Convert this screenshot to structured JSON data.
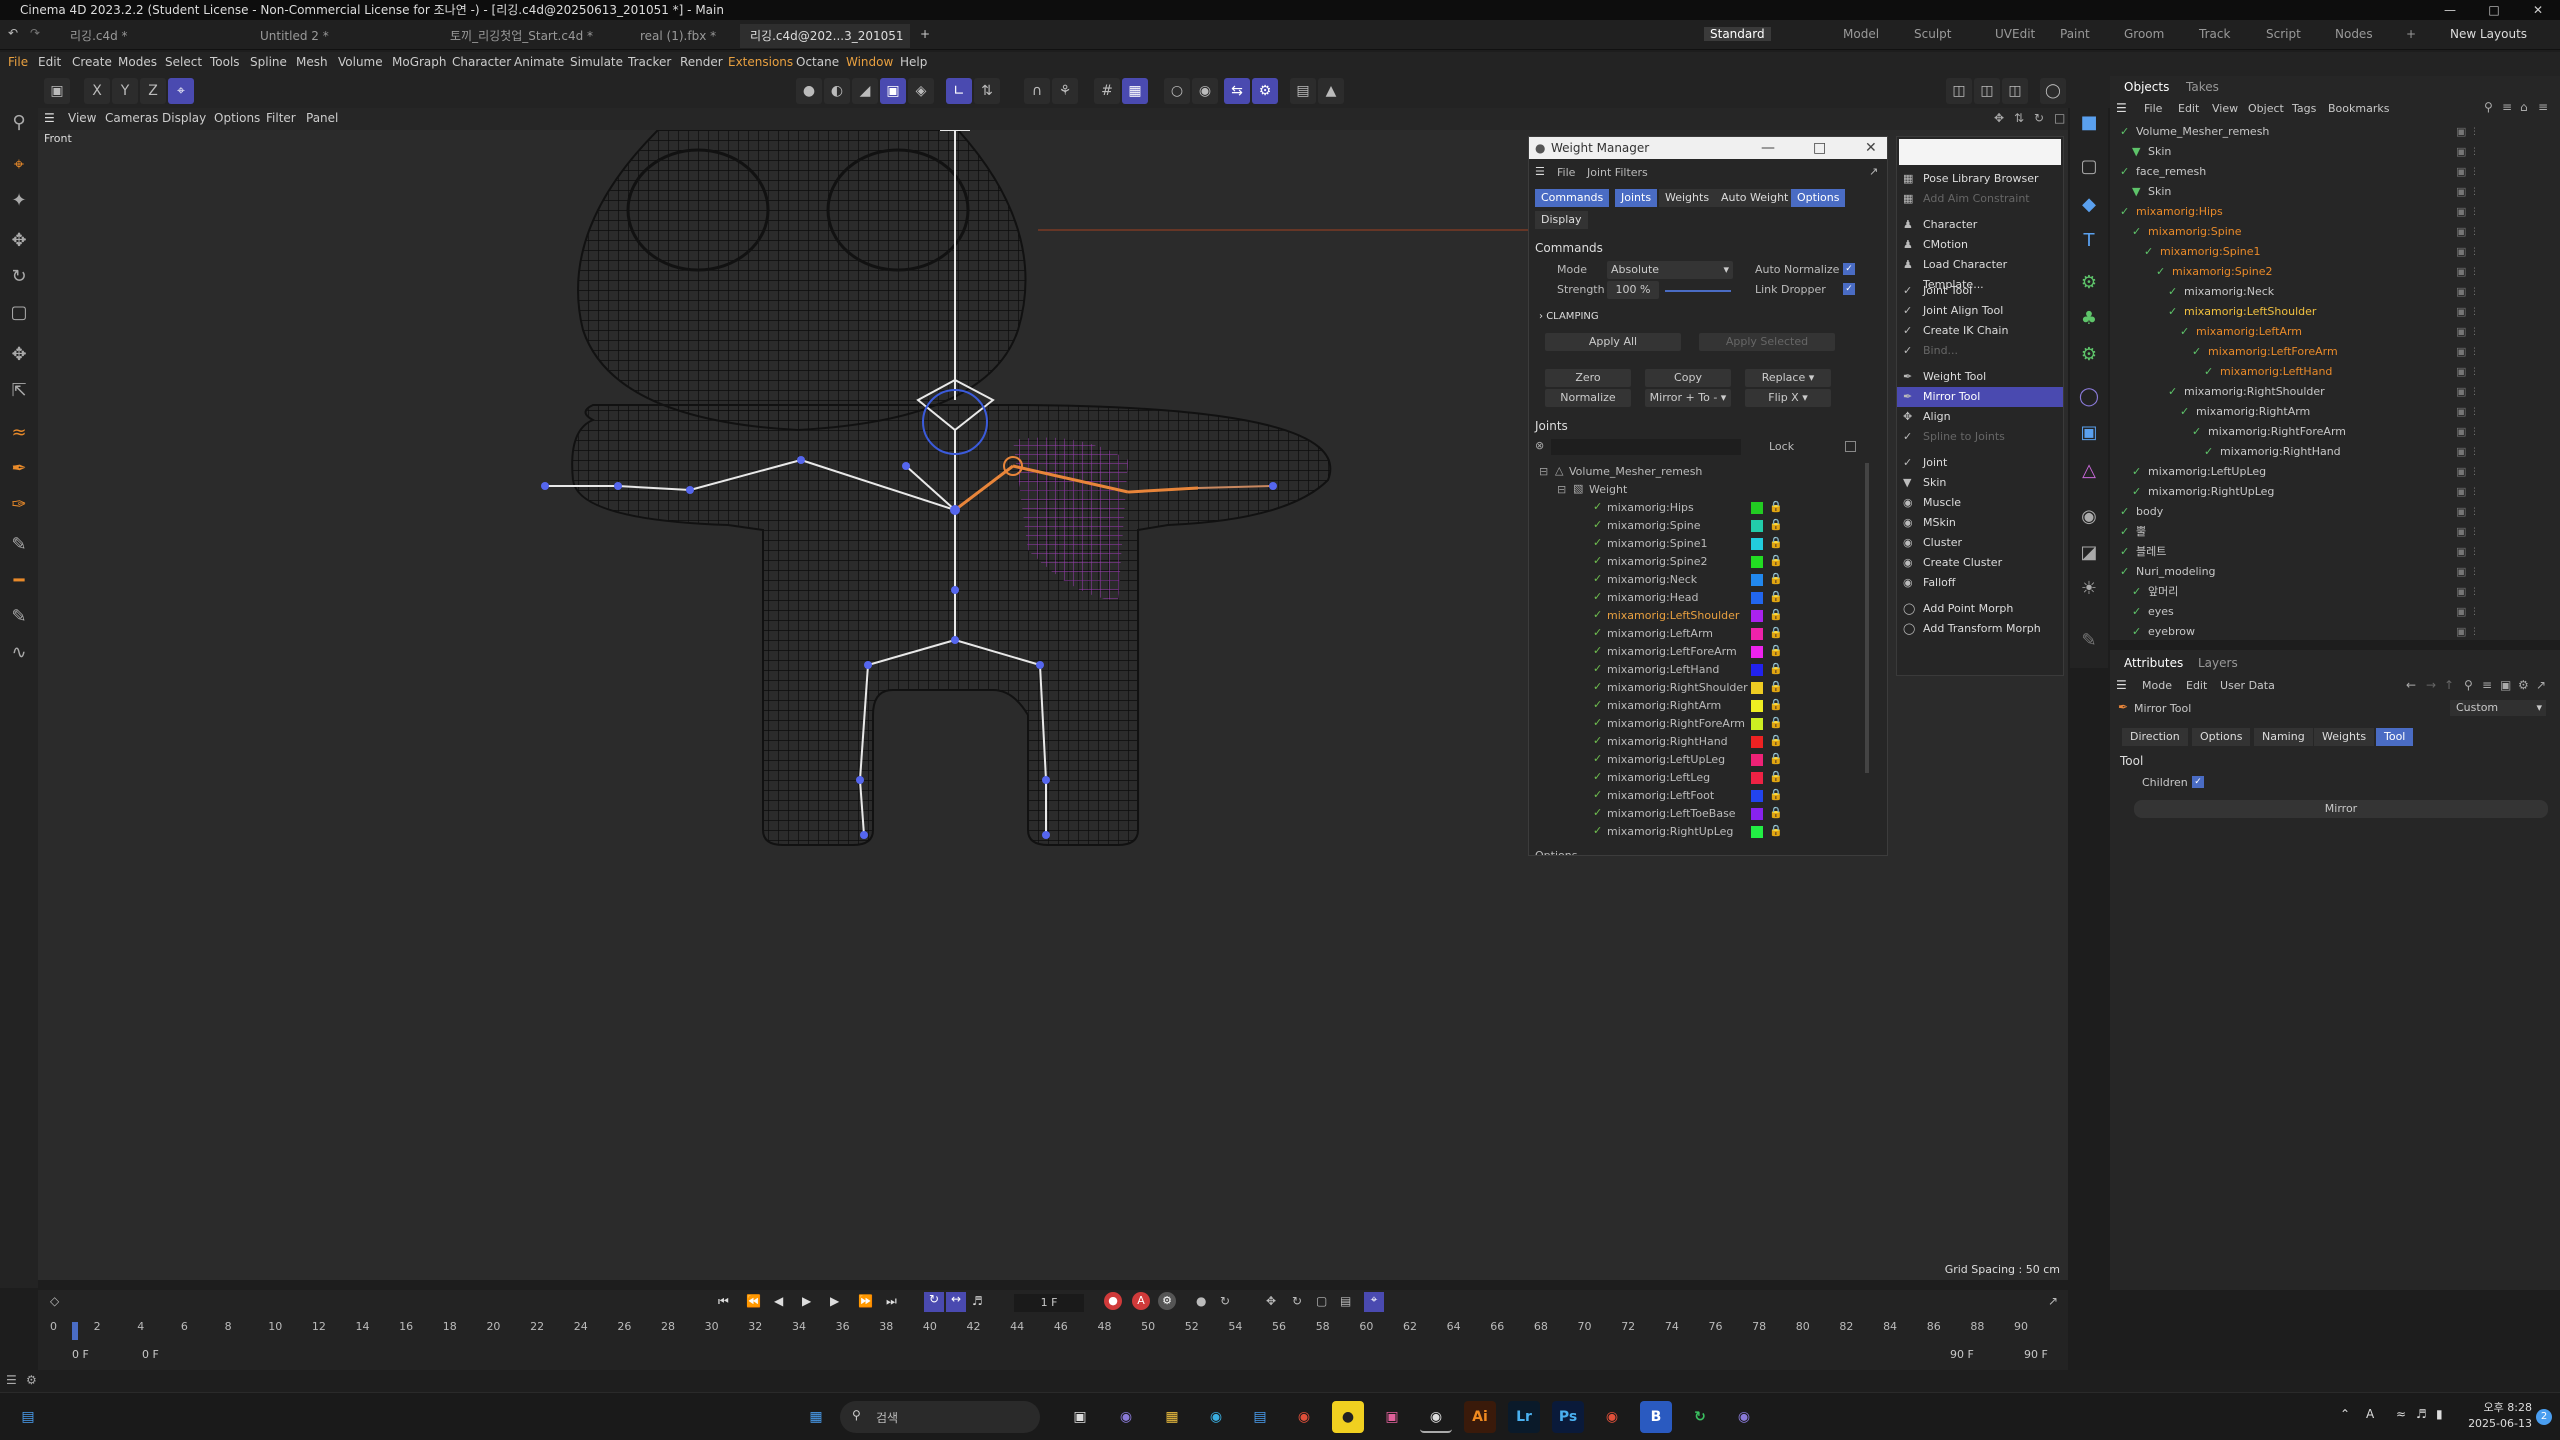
{
  "window": {
    "title": "Cinema 4D 2023.2.2 (Student License - Non-Commercial License for 조나연 -) - [리깅.c4d@20250613_201051 *] - Main"
  },
  "file_tabs": [
    "리깅.c4d *",
    "Untitled 2 *",
    "토끼_리깅첫업_Start.c4d *",
    "real (1).fbx *",
    "리깅.c4d@202...3_201051 *"
  ],
  "layouts": [
    "Standard",
    "Model",
    "Sculpt",
    "UVEdit",
    "Paint",
    "Groom",
    "Track",
    "Script",
    "Nodes",
    "New Layouts"
  ],
  "menu": [
    "File",
    "Edit",
    "Create",
    "Modes",
    "Select",
    "Tools",
    "Spline",
    "Mesh",
    "Volume",
    "MoGraph",
    "Character",
    "Animate",
    "Simulate",
    "Tracker",
    "Render",
    "Extensions",
    "Octane",
    "Window",
    "Help"
  ],
  "viewport": {
    "menu": [
      "View",
      "Cameras",
      "Display",
      "Options",
      "Filter",
      "Panel"
    ],
    "label": "Front",
    "grid_spacing": "Grid Spacing : 50 cm"
  },
  "weight_manager": {
    "title": "Weight Manager",
    "menu": [
      "File",
      "Joint Filters"
    ],
    "tabs": [
      "Commands",
      "Joints",
      "Weights",
      "Auto Weight",
      "Options",
      "Display"
    ],
    "section": "Commands",
    "mode_label": "Mode",
    "mode_value": "Absolute",
    "auto_normalize": "Auto Normalize",
    "strength_label": "Strength",
    "strength_value": "100 %",
    "link_dropper": "Link Dropper",
    "clamping": "CLAMPING",
    "apply_all": "Apply All",
    "apply_selected": "Apply Selected",
    "zero": "Zero",
    "copy": "Copy",
    "replace": "Replace",
    "normalize": "Normalize",
    "mirror": "Mirror + To -",
    "flip": "Flip X",
    "joints_label": "Joints",
    "lock_label": "Lock",
    "root": "Volume_Mesher_remesh",
    "weight_tag": "Weight",
    "joints": [
      {
        "name": "mixamorig:Hips",
        "color": "#22cc22"
      },
      {
        "name": "mixamorig:Spine",
        "color": "#22ccaa"
      },
      {
        "name": "mixamorig:Spine1",
        "color": "#22ccdd"
      },
      {
        "name": "mixamorig:Spine2",
        "color": "#22dd22"
      },
      {
        "name": "mixamorig:Neck",
        "color": "#2288ee"
      },
      {
        "name": "mixamorig:Head",
        "color": "#2266ee"
      },
      {
        "name": "mixamorig:LeftShoulder",
        "color": "#aa22ee",
        "selected": true
      },
      {
        "name": "mixamorig:LeftArm",
        "color": "#ee22aa"
      },
      {
        "name": "mixamorig:LeftForeArm",
        "color": "#ee22ee"
      },
      {
        "name": "mixamorig:LeftHand",
        "color": "#2222ee"
      },
      {
        "name": "mixamorig:RightShoulder",
        "color": "#eecc22"
      },
      {
        "name": "mixamorig:RightArm",
        "color": "#eeee22"
      },
      {
        "name": "mixamorig:RightForeArm",
        "color": "#ccee22"
      },
      {
        "name": "mixamorig:RightHand",
        "color": "#ee2222"
      },
      {
        "name": "mixamorig:LeftUpLeg",
        "color": "#ee2277"
      },
      {
        "name": "mixamorig:LeftLeg",
        "color": "#ee2244"
      },
      {
        "name": "mixamorig:LeftFoot",
        "color": "#2244ee"
      },
      {
        "name": "mixamorig:LeftToeBase",
        "color": "#8822ee"
      },
      {
        "name": "mixamorig:RightUpLeg",
        "color": "#22ee44"
      }
    ],
    "options_footer": "Options"
  },
  "character_menu": {
    "items": [
      {
        "label": "Pose Library Browser",
        "disabled": false
      },
      {
        "label": "Add Aim Constraint",
        "disabled": true
      },
      {
        "label": "Character",
        "disabled": false
      },
      {
        "label": "CMotion",
        "disabled": false
      },
      {
        "label": "Load Character Template...",
        "disabled": false
      },
      {
        "label": "Joint Tool",
        "disabled": false
      },
      {
        "label": "Joint Align Tool",
        "disabled": false
      },
      {
        "label": "Create IK Chain",
        "disabled": false
      },
      {
        "label": "Bind...",
        "disabled": true
      },
      {
        "label": "Weight Tool",
        "disabled": false
      },
      {
        "label": "Mirror Tool",
        "disabled": false,
        "selected": true
      },
      {
        "label": "Align",
        "disabled": false
      },
      {
        "label": "Spline to Joints",
        "disabled": true
      },
      {
        "label": "Joint",
        "disabled": false
      },
      {
        "label": "Skin",
        "disabled": false
      },
      {
        "label": "Muscle",
        "disabled": false
      },
      {
        "label": "MSkin",
        "disabled": false
      },
      {
        "label": "Cluster",
        "disabled": false
      },
      {
        "label": "Create Cluster",
        "disabled": false
      },
      {
        "label": "Falloff",
        "disabled": false
      },
      {
        "label": "Add Point Morph",
        "disabled": false
      },
      {
        "label": "Add Transform Morph",
        "disabled": false
      }
    ]
  },
  "objects_panel": {
    "tabs": [
      "Objects",
      "Takes"
    ],
    "menu": [
      "File",
      "Edit",
      "View",
      "Object",
      "Tags",
      "Bookmarks"
    ],
    "items": [
      {
        "label": "Volume_Mesher_remesh",
        "indent": 0,
        "style": "normal"
      },
      {
        "label": "Skin",
        "indent": 1,
        "style": "normal"
      },
      {
        "label": "face_remesh",
        "indent": 0,
        "style": "normal"
      },
      {
        "label": "Skin",
        "indent": 1,
        "style": "normal"
      },
      {
        "label": "mixamorig:Hips",
        "indent": 0,
        "style": "orange"
      },
      {
        "label": "mixamorig:Spine",
        "indent": 1,
        "style": "orange"
      },
      {
        "label": "mixamorig:Spine1",
        "indent": 2,
        "style": "orange"
      },
      {
        "label": "mixamorig:Spine2",
        "indent": 3,
        "style": "orange"
      },
      {
        "label": "mixamorig:Neck",
        "indent": 4,
        "style": "normal"
      },
      {
        "label": "mixamorig:LeftShoulder",
        "indent": 4,
        "style": "highlight"
      },
      {
        "label": "mixamorig:LeftArm",
        "indent": 5,
        "style": "orange"
      },
      {
        "label": "mixamorig:LeftForeArm",
        "indent": 6,
        "style": "orange"
      },
      {
        "label": "mixamorig:LeftHand",
        "indent": 7,
        "style": "orange"
      },
      {
        "label": "mixamorig:RightShoulder",
        "indent": 4,
        "style": "normal"
      },
      {
        "label": "mixamorig:RightArm",
        "indent": 5,
        "style": "normal"
      },
      {
        "label": "mixamorig:RightForeArm",
        "indent": 6,
        "style": "normal"
      },
      {
        "label": "mixamorig:RightHand",
        "indent": 7,
        "style": "normal"
      },
      {
        "label": "mixamorig:LeftUpLeg",
        "indent": 1,
        "style": "normal"
      },
      {
        "label": "mixamorig:RightUpLeg",
        "indent": 1,
        "style": "normal"
      },
      {
        "label": "body",
        "indent": 0,
        "style": "normal"
      },
      {
        "label": "뿔",
        "indent": 0,
        "style": "normal"
      },
      {
        "label": "블레트",
        "indent": 0,
        "style": "normal"
      },
      {
        "label": "Nuri_modeling",
        "indent": 0,
        "style": "normal"
      },
      {
        "label": "앞머리",
        "indent": 1,
        "style": "normal"
      },
      {
        "label": "eyes",
        "indent": 1,
        "style": "normal"
      },
      {
        "label": "eyebrow",
        "indent": 1,
        "style": "normal"
      }
    ]
  },
  "attributes_panel": {
    "tabs": [
      "Attributes",
      "Layers"
    ],
    "menu": [
      "Mode",
      "Edit",
      "User Data"
    ],
    "tool_name": "Mirror Tool",
    "preset": "Custom",
    "subtabs": [
      "Direction",
      "Options",
      "Naming",
      "Weights",
      "Tool"
    ],
    "section": "Tool",
    "children_label": "Children",
    "mirror_button": "Mirror"
  },
  "timeline": {
    "frame": "1 F",
    "ticks": [
      "0",
      "2",
      "4",
      "6",
      "8",
      "10",
      "12",
      "14",
      "16",
      "18",
      "20",
      "22",
      "24",
      "26",
      "28",
      "30",
      "32",
      "34",
      "36",
      "38",
      "40",
      "42",
      "44",
      "46",
      "48",
      "50",
      "52",
      "54",
      "56",
      "58",
      "60",
      "62",
      "64",
      "66",
      "68",
      "70",
      "72",
      "74",
      "76",
      "78",
      "80",
      "82",
      "84",
      "86",
      "88",
      "90"
    ],
    "start": "0 F",
    "start2": "0 F",
    "end": "90 F",
    "end2": "90 F"
  },
  "taskbar": {
    "search_placeholder": "검색",
    "time": "오후 8:28",
    "date": "2025-06-13",
    "lang": "A",
    "notif": "2"
  }
}
